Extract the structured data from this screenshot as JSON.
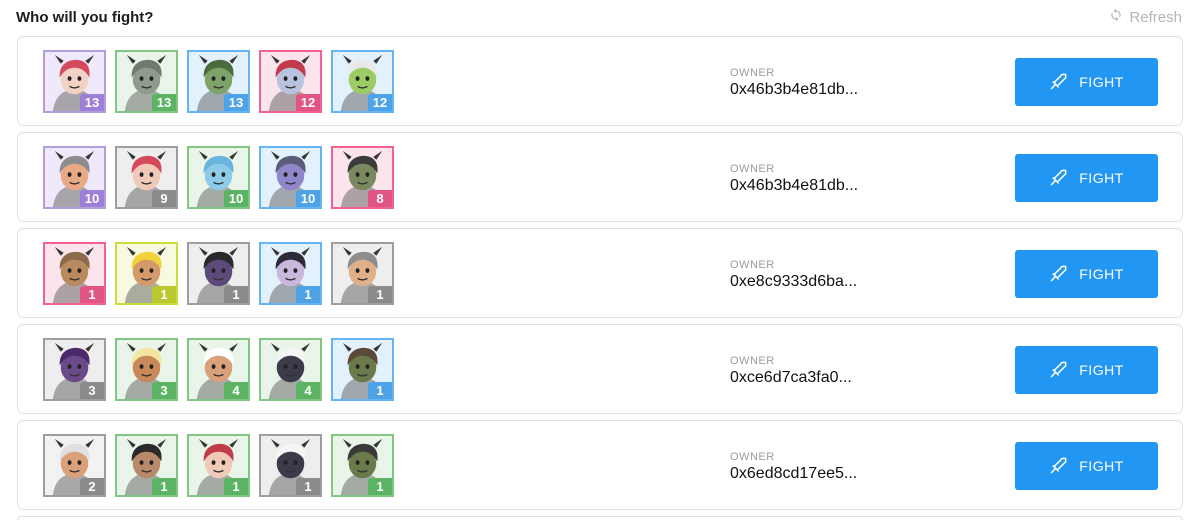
{
  "header": {
    "title": "Who will you fight?",
    "refresh_label": "Refresh",
    "refresh_icon": "refresh-icon"
  },
  "colors": {
    "accent": "#2196f3"
  },
  "opponents": [
    {
      "owner_label": "OWNER",
      "owner": "0x46b3b4e81db...",
      "fight_label": "FIGHT",
      "heroes": [
        {
          "level": "13",
          "frame": "#b39ddb",
          "badge": "#9c7fd6",
          "bg": "#efe9fb",
          "skin": "#f2d2c4",
          "hair": "#d44a5a"
        },
        {
          "level": "13",
          "frame": "#81c784",
          "badge": "#5cb363",
          "bg": "#e8f5e8",
          "skin": "#8f9b8c",
          "hair": "#6f7a70"
        },
        {
          "level": "13",
          "frame": "#64b5f6",
          "badge": "#4ea3e6",
          "bg": "#e3f1fc",
          "skin": "#7ea36a",
          "hair": "#4b6b3c"
        },
        {
          "level": "12",
          "frame": "#f06292",
          "badge": "#e15583",
          "bg": "#fbe4ec",
          "skin": "#b9c3e0",
          "hair": "#c23b4a"
        },
        {
          "level": "12",
          "frame": "#64b5f6",
          "badge": "#4ea3e6",
          "bg": "#e3f1fc",
          "skin": "#9ccc65",
          "hair": "#e9e9e9"
        }
      ]
    },
    {
      "owner_label": "OWNER",
      "owner": "0x46b3b4e81db...",
      "fight_label": "FIGHT",
      "heroes": [
        {
          "level": "10",
          "frame": "#b39ddb",
          "badge": "#9c7fd6",
          "bg": "#efe9fb",
          "skin": "#e8a985",
          "hair": "#8d8d8d"
        },
        {
          "level": "9",
          "frame": "#9e9e9e",
          "badge": "#8a8a8a",
          "bg": "#eeeeee",
          "skin": "#f0c9b8",
          "hair": "#d44a5a"
        },
        {
          "level": "10",
          "frame": "#81c784",
          "badge": "#5cb363",
          "bg": "#e8f5e8",
          "skin": "#8ecbe8",
          "hair": "#6ab4de"
        },
        {
          "level": "10",
          "frame": "#64b5f6",
          "badge": "#4ea3e6",
          "bg": "#e3f1fc",
          "skin": "#8f87c9",
          "hair": "#5b5b7a"
        },
        {
          "level": "8",
          "frame": "#f06292",
          "badge": "#e15583",
          "bg": "#fbe4ec",
          "skin": "#7a8a5e",
          "hair": "#3b3b3b"
        }
      ]
    },
    {
      "owner_label": "OWNER",
      "owner": "0xe8c9333d6ba...",
      "fight_label": "FIGHT",
      "heroes": [
        {
          "level": "1",
          "frame": "#f06292",
          "badge": "#e15583",
          "bg": "#fbe4ec",
          "skin": "#b98a5e",
          "hair": "#8a6b4a"
        },
        {
          "level": "1",
          "frame": "#cddc39",
          "badge": "#b8c82e",
          "bg": "#f7fadf",
          "skin": "#d49a6a",
          "hair": "#f2d23c"
        },
        {
          "level": "1",
          "frame": "#9e9e9e",
          "badge": "#8a8a8a",
          "bg": "#eeeeee",
          "skin": "#5d4a7a",
          "hair": "#2a2a2a"
        },
        {
          "level": "1",
          "frame": "#64b5f6",
          "badge": "#4ea3e6",
          "bg": "#e3f1fc",
          "skin": "#c8b8dc",
          "hair": "#2e2a3a"
        },
        {
          "level": "1",
          "frame": "#9e9e9e",
          "badge": "#8a8a8a",
          "bg": "#eeeeee",
          "skin": "#e0b08a",
          "hair": "#8d8d8d"
        }
      ]
    },
    {
      "owner_label": "OWNER",
      "owner": "0xce6d7ca3fa0...",
      "fight_label": "FIGHT",
      "heroes": [
        {
          "level": "3",
          "frame": "#9e9e9e",
          "badge": "#8a8a8a",
          "bg": "#eeeeee",
          "skin": "#6a4a8a",
          "hair": "#4a2a6a"
        },
        {
          "level": "3",
          "frame": "#81c784",
          "badge": "#5cb363",
          "bg": "#e8f5e8",
          "skin": "#c98a5a",
          "hair": "#f2e6a0"
        },
        {
          "level": "4",
          "frame": "#81c784",
          "badge": "#5cb363",
          "bg": "#e8f5e8",
          "skin": "#d9a07a",
          "hair": "#ffffff"
        },
        {
          "level": "4",
          "frame": "#81c784",
          "badge": "#5cb363",
          "bg": "#e8f5e8",
          "skin": "#3b3b4a",
          "hair": "#f5f5f5"
        },
        {
          "level": "1",
          "frame": "#64b5f6",
          "badge": "#4ea3e6",
          "bg": "#e3f1fc",
          "skin": "#6b7a4a",
          "hair": "#5b4a3a"
        }
      ]
    },
    {
      "owner_label": "OWNER",
      "owner": "0x6ed8cd17ee5...",
      "fight_label": "FIGHT",
      "heroes": [
        {
          "level": "2",
          "frame": "#9e9e9e",
          "badge": "#8a8a8a",
          "bg": "#f2f2f2",
          "skin": "#d9a07a",
          "hair": "#e0e0e0"
        },
        {
          "level": "1",
          "frame": "#81c784",
          "badge": "#5cb363",
          "bg": "#e8f5e8",
          "skin": "#b98a6a",
          "hair": "#2a2a2a"
        },
        {
          "level": "1",
          "frame": "#81c784",
          "badge": "#5cb363",
          "bg": "#e8f5e8",
          "skin": "#f0c9b8",
          "hair": "#c23b4a"
        },
        {
          "level": "1",
          "frame": "#9e9e9e",
          "badge": "#8a8a8a",
          "bg": "#eeeeee",
          "skin": "#3b3b4a",
          "hair": "#f5f5f5"
        },
        {
          "level": "1",
          "frame": "#81c784",
          "badge": "#5cb363",
          "bg": "#e8f5e8",
          "skin": "#6b7a4a",
          "hair": "#3a3a3a"
        }
      ]
    }
  ]
}
